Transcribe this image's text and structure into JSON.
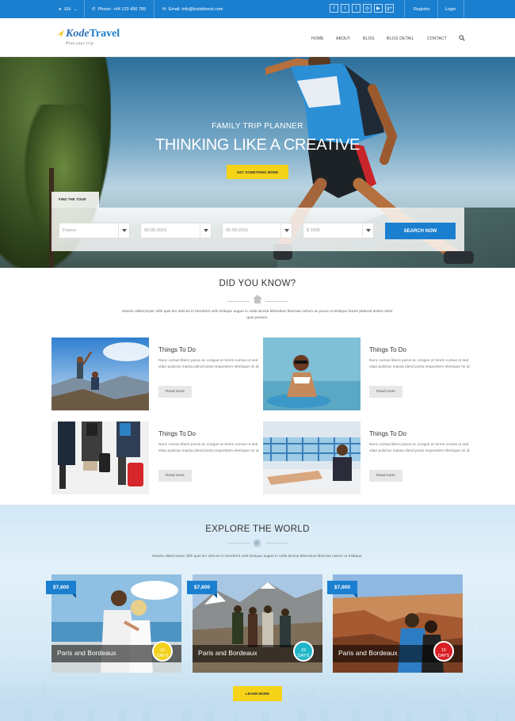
{
  "topbar": {
    "language": "EN",
    "phone": "Phone: +44 123 456 789",
    "email": "Email: info@kodeforest.com",
    "socials": [
      "f",
      "t",
      "t",
      "◎",
      "▶",
      "g+"
    ],
    "register": "Register",
    "login": "Login"
  },
  "logo": {
    "name_part1": "Kode",
    "name_part2": "Travel",
    "tagline": "Plan your trip"
  },
  "nav": {
    "items": [
      "HOME",
      "ABOUT",
      "BLOG",
      "BLOG DETAIL",
      "CONTACT"
    ]
  },
  "hero": {
    "subtitle": "FAMILY TRIP PLANNER",
    "title": "THINKING LIKE A CREATIVE",
    "button": "GET SOMETHING MORE"
  },
  "tour_search": {
    "tab_label": "FIND THE TOUR",
    "destination": "France",
    "date_from": "00-00-2015",
    "date_to": "00-00-2015",
    "price": "$ 1500",
    "search_button": "SEARCH NOW"
  },
  "did_you_know": {
    "title": "DID YOU KNOW?",
    "text": "Mauris ullamcorper nibh quis leo ultrices in hendrerit velit tristique augue in nulla lacinia bibendum liberoas rutrum ac purus ut tristique lictum platerat teolne dolor quis pretium.",
    "cards": [
      {
        "title": "Things To Do",
        "text": "Nunc cursus libero purus ac congue ar lorem cursus ut sed vitae pulvinar massa idend porta nequestem elerisque mi id.",
        "button": "Read more"
      },
      {
        "title": "Things To Do",
        "text": "Nunc cursus libero purus ac congue ar lorem cursus ut sed vitae pulvinar massa idend porta nequestem elerisque mi id.",
        "button": "Read more"
      },
      {
        "title": "Things To Do",
        "text": "Nunc cursus libero purus ac congue ar lorem cursus ut sed vitae pulvinar massa idend porta nequestem elerisque mi id.",
        "button": "Read more"
      },
      {
        "title": "Things To Do",
        "text": "Nunc cursus libero purus ac congue ar lorem cursus ut sed vitae pulvinar massa idend porta nequestem elerisque mi id.",
        "button": "Read more"
      }
    ]
  },
  "explore": {
    "title": "EXPLORE THE WORLD",
    "text": "Mauris ullamcorper nibh quis leo ultrices in hendrerit velit tristique augue in nulla lacinia bibendum liberoas rutrum ut tristique.",
    "tours": [
      {
        "price": "$7,600",
        "name": "Paris and Bordeaux",
        "days_num": "15",
        "days_label": "DAYS",
        "badge_color": "#f2d01b"
      },
      {
        "price": "$7,600",
        "name": "Paris and Bordeaux",
        "days_num": "15",
        "days_label": "DAYS",
        "badge_color": "#20b6c9"
      },
      {
        "price": "$7,600",
        "name": "Paris and Bordeaux",
        "days_num": "15",
        "days_label": "DAYS",
        "badge_color": "#d91f26"
      }
    ],
    "button": "LEARN MORE"
  },
  "colors": {
    "primary": "#1b7fcf",
    "accent": "#f5d318"
  }
}
